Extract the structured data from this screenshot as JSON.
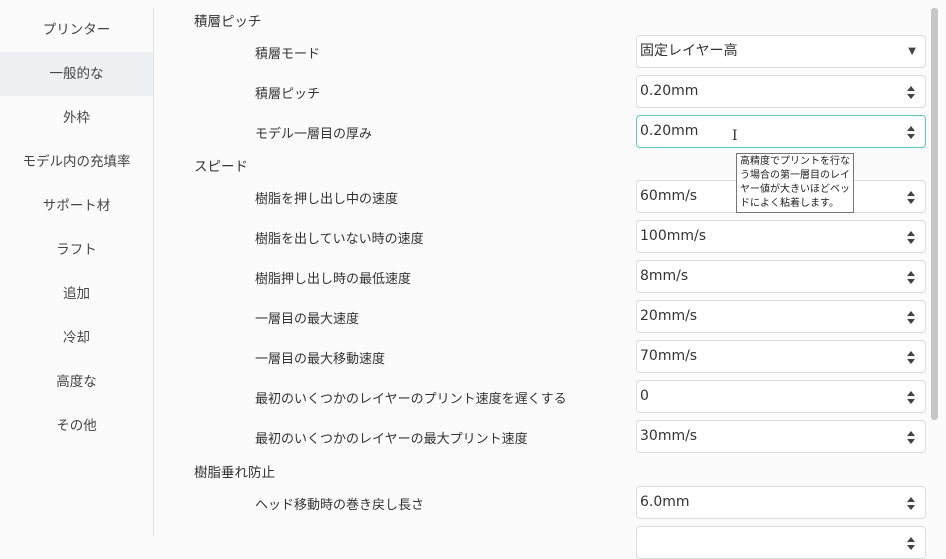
{
  "sidebar": {
    "items": [
      "プリンター",
      "一般的な",
      "外枠",
      "モデル内の充填率",
      "サポート材",
      "ラフト",
      "追加",
      "冷却",
      "高度な",
      "その他"
    ],
    "active": 1
  },
  "sections": {
    "layer": "積層ピッチ",
    "speed": "スピード",
    "retract": "樹脂垂れ防止"
  },
  "rows": [
    {
      "label": "積層モード",
      "value": "固定レイヤー高",
      "type": "select"
    },
    {
      "label": "積層ピッチ",
      "value": "0.20mm"
    },
    {
      "label": "モデル一層目の厚み",
      "value": "0.20mm"
    },
    {
      "label": "樹脂を押し出し中の速度",
      "value": "60mm/s"
    },
    {
      "label": "樹脂を出していない時の速度",
      "value": "100mm/s"
    },
    {
      "label": "樹脂押し出し時の最低速度",
      "value": "8mm/s"
    },
    {
      "label": "一層目の最大速度",
      "value": "20mm/s"
    },
    {
      "label": "一層目の最大移動速度",
      "value": "70mm/s"
    },
    {
      "label": "最初のいくつかのレイヤーのプリント速度を遅くする",
      "value": "0"
    },
    {
      "label": "最初のいくつかのレイヤーの最大プリント速度",
      "value": "30mm/s"
    },
    {
      "label": "ヘッド移動時の巻き戻し長さ",
      "value": "6.0mm"
    },
    {
      "label": "",
      "value": ""
    }
  ],
  "tooltip": "高精度でプリントを行なう場合の第一層目のレイヤー値が大きいほどベッドによく粘着します。",
  "colors": {
    "focus": "#5fc8b4",
    "active_bg": "#eff0f1"
  }
}
